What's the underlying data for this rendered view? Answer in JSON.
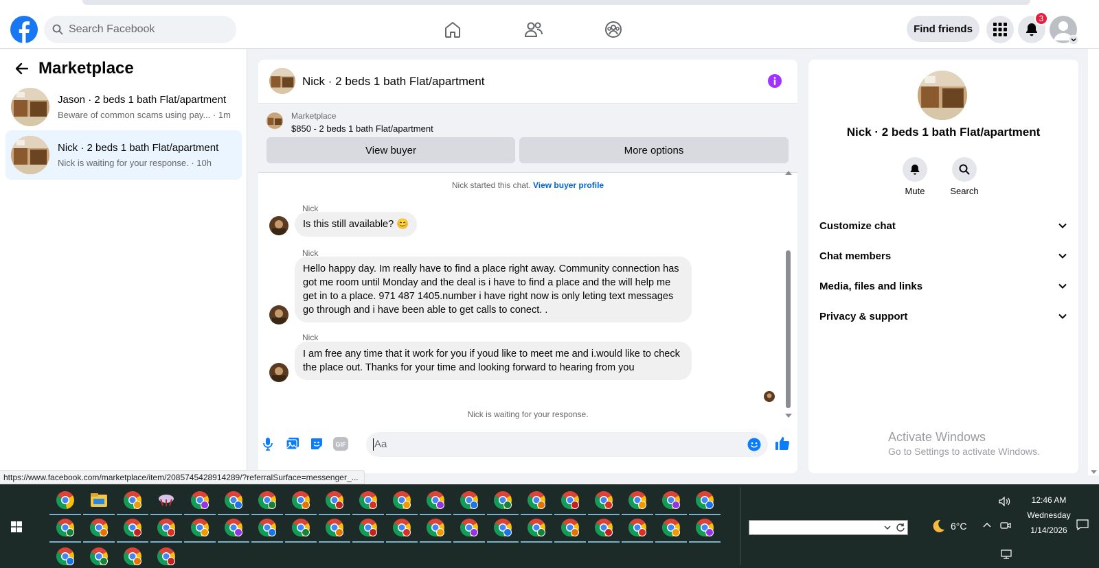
{
  "header": {
    "search_placeholder": "Search Facebook",
    "find_friends": "Find friends",
    "notification_count": "3",
    "brand_color": "#1877f2"
  },
  "sidebar": {
    "title": "Marketplace",
    "conversations": [
      {
        "name": "Jason · 2 beds 1 bath Flat/apartment",
        "preview": "Beware of common scams using pay...",
        "time": " · 1m"
      },
      {
        "name": "Nick · 2 beds 1 bath Flat/apartment",
        "preview": "Nick is waiting for your response.",
        "time": " · 10h"
      }
    ]
  },
  "chat": {
    "title": "Nick · 2 beds 1 bath Flat/apartment",
    "listing": {
      "label": "Marketplace",
      "price_title": "$850 - 2 beds 1 bath Flat/apartment",
      "view_buyer": "View buyer",
      "more_options": "More options"
    },
    "started_text": "Nick started this chat.",
    "view_profile": "View buyer profile",
    "messages": [
      {
        "sender": "Nick",
        "text": "Is this still available? 😊"
      },
      {
        "sender": "Nick",
        "text": "Hello happy day.  Im really have to find a place right away. Community connection has got me room until Monday and the deal is i have to find a place and the will help me get in to a place. 971 487 1405.number i have right now is only leting text messages go through and i have been able to get calls to conect. ."
      },
      {
        "sender": "Nick",
        "text": "I am free any time that it work for you if youd like to meet me and i.would like to check the place out.  Thanks for your time and looking forward to hearing from you"
      }
    ],
    "waiting_text": "Nick is waiting for your response.",
    "composer_placeholder": "Aa"
  },
  "details": {
    "name": "Nick · 2 beds 1 bath Flat/apartment",
    "actions": [
      {
        "label": "Mute",
        "icon": "bell-icon"
      },
      {
        "label": "Search",
        "icon": "search-icon"
      }
    ],
    "sections": [
      "Customize chat",
      "Chat members",
      "Media, files and links",
      "Privacy & support"
    ]
  },
  "watermark": {
    "title": "Activate Windows",
    "subtitle": "Go to Settings to activate Windows."
  },
  "status_url": "https://www.facebook.com/marketplace/item/2085745428914289/?referralSurface=messenger_...",
  "taskbar": {
    "temperature": "6°C",
    "time": "12:46 AM",
    "day": "Wednesday",
    "date": "1/14/2026"
  }
}
